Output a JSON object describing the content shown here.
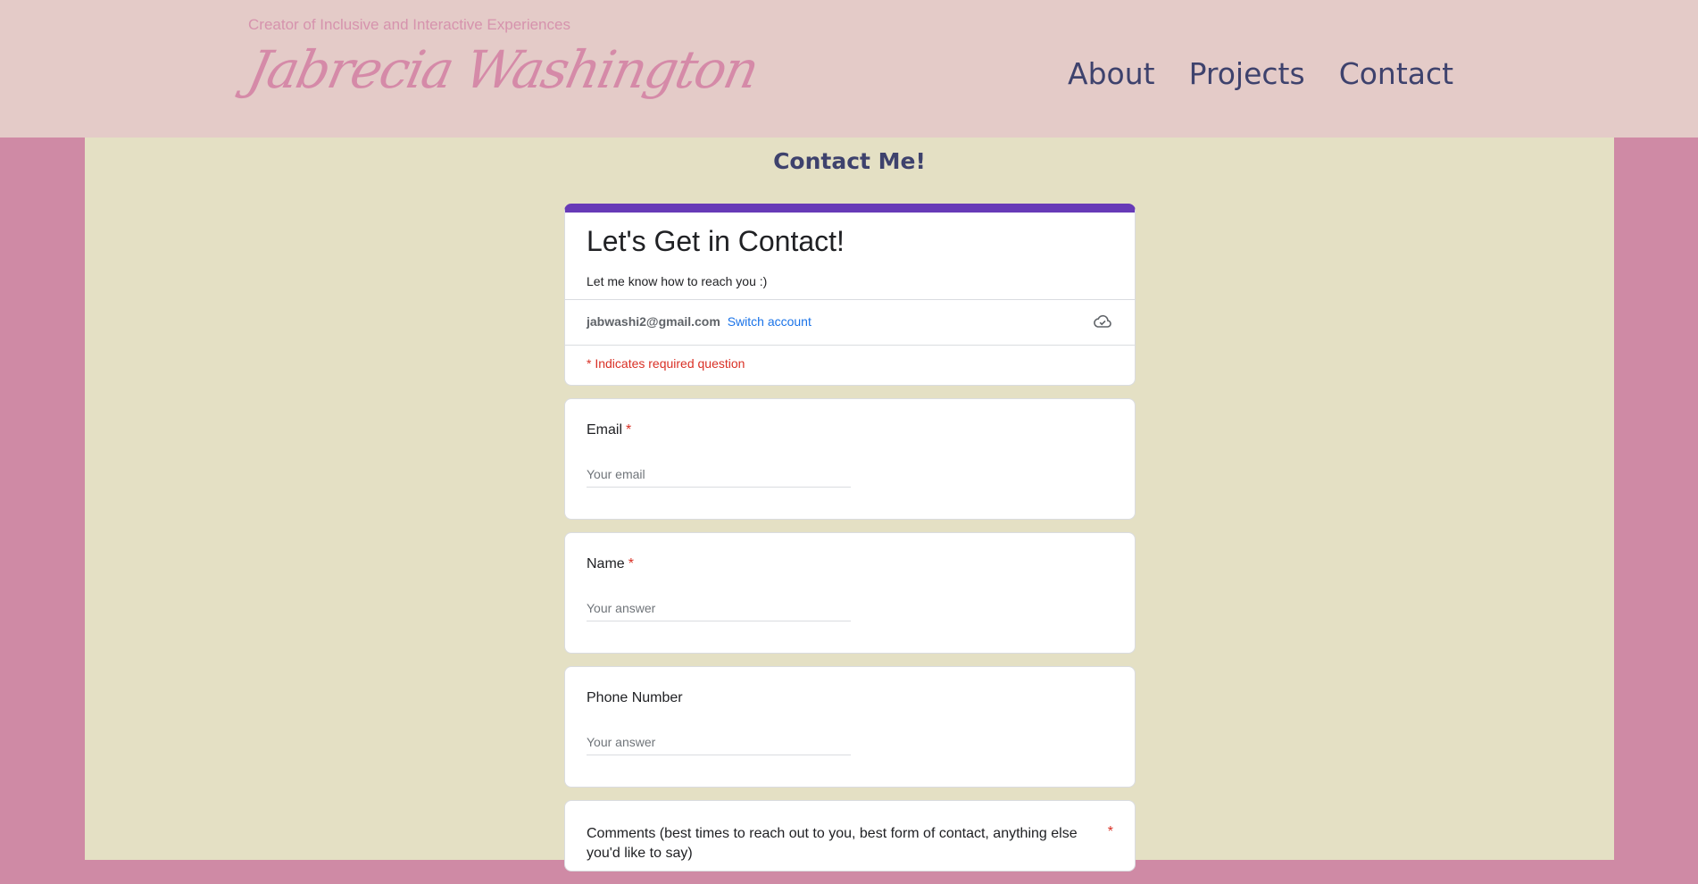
{
  "header": {
    "tagline": "Creator of Inclusive and Interactive Experiences",
    "logo_text": "Jabrecia Washington",
    "nav": [
      "About",
      "Projects",
      "Contact"
    ]
  },
  "page": {
    "title": "Contact Me!"
  },
  "form": {
    "title": "Let's Get in Contact!",
    "description": "Let me know how to reach you :)",
    "account_email": "jabwashi2@gmail.com",
    "switch_account": "Switch account",
    "cloud_icon": "cloud-saved-icon",
    "required_note": "* Indicates required question",
    "questions": [
      {
        "label": "Email",
        "required": "*",
        "placeholder": "Your email"
      },
      {
        "label": "Name",
        "required": "*",
        "placeholder": "Your answer"
      },
      {
        "label": "Phone Number",
        "required": "",
        "placeholder": "Your answer"
      },
      {
        "label": "Comments (best times to reach out to you, best form of contact, anything else you'd like to say)",
        "required": "*"
      }
    ]
  },
  "colors": {
    "side_bg": "#cf8aa5",
    "header_bg": "#e4cbc8",
    "main_bg": "#e4e0c4",
    "accent": "#673ab7",
    "nav_text": "#3e426d"
  }
}
